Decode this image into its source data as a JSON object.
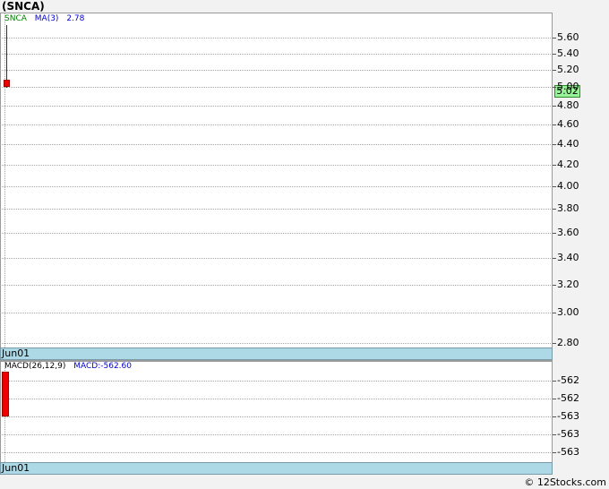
{
  "title": "(SNCA)",
  "watermark": "© 12Stocks.com",
  "chart_data": [
    {
      "type": "candlestick",
      "legend": [
        {
          "text": "SNCA",
          "color": "#008000"
        },
        {
          "text": "MA(3)",
          "color": "#0000cc"
        },
        {
          "text": "2.78",
          "color": "#0000cc"
        }
      ],
      "x_labels": [
        "Jun01"
      ],
      "y_ticks": [
        5.6,
        5.4,
        5.2,
        5.0,
        4.8,
        4.6,
        4.4,
        4.2,
        4.0,
        3.8,
        3.6,
        3.4,
        3.2,
        3.0,
        2.8
      ],
      "y_tick_labels": [
        "5.60",
        "5.40",
        "5.20",
        "5.00",
        "4.80",
        "4.60",
        "4.40",
        "4.20",
        "4.00",
        "3.80",
        "3.60",
        "3.40",
        "3.20",
        "3.00",
        "2.80"
      ],
      "ylim": [
        2.75,
        5.7
      ],
      "last_price_label": "5.02",
      "candles": [
        {
          "date": "Jun01",
          "open": 5.08,
          "close": 5.0,
          "high": 5.9,
          "low": 4.99
        }
      ],
      "grid": true
    },
    {
      "type": "bar",
      "legend": [
        {
          "text": "MACD(26,12,9)",
          "color": "#000000"
        },
        {
          "text": "MACD:-562.60",
          "color": "#0000cc"
        }
      ],
      "x_labels": [
        "Jun01"
      ],
      "y_ticks": [
        -562.2,
        -562.4,
        -562.6,
        -562.8,
        -563.0
      ],
      "y_tick_labels": [
        "-562",
        "-562",
        "-563",
        "-563",
        "-563"
      ],
      "ylim": [
        -563.1,
        -562.1
      ],
      "values": [
        {
          "date": "Jun01",
          "top": -562.05,
          "bottom": -562.6
        }
      ],
      "grid": true
    }
  ]
}
